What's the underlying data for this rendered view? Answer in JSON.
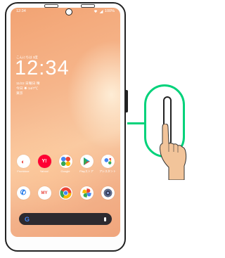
{
  "status_bar": {
    "time": "12:34",
    "battery": "100%"
  },
  "lock_screen": {
    "small_label": "こんにちは 3度",
    "clock": "12:34",
    "date": "11/22 日曜日 晴",
    "weather": "今日 ☀ 14/7℃",
    "place": "東京"
  },
  "apps_row1": [
    {
      "label": "Frontdoor",
      "icon": "frontdoor-icon",
      "color": "#e8453c"
    },
    {
      "label": "Yahoo!",
      "icon": "yahoo-icon",
      "color": "#ff0033"
    },
    {
      "label": "Google",
      "icon": "google-apps-icon",
      "color": "#34a853"
    },
    {
      "label": "Playストア",
      "icon": "play-store-icon",
      "color": "#00a0e9"
    },
    {
      "label": "アシスタント",
      "icon": "assistant-icon",
      "color": "#4285f4"
    }
  ],
  "apps_row2": [
    {
      "label": "",
      "icon": "phone-icon",
      "color": "#1a73e8"
    },
    {
      "label": "",
      "icon": "softbank-icon",
      "color": "#9e9e9e"
    },
    {
      "label": "",
      "icon": "chrome-icon",
      "color": "#ea4335"
    },
    {
      "label": "",
      "icon": "photos-icon",
      "color": "#fbbc04"
    },
    {
      "label": "",
      "icon": "camera-icon",
      "color": "#5f6b8a"
    }
  ],
  "search_bar": {
    "logo": "G"
  },
  "colors": {
    "accent": "#00d27a"
  }
}
